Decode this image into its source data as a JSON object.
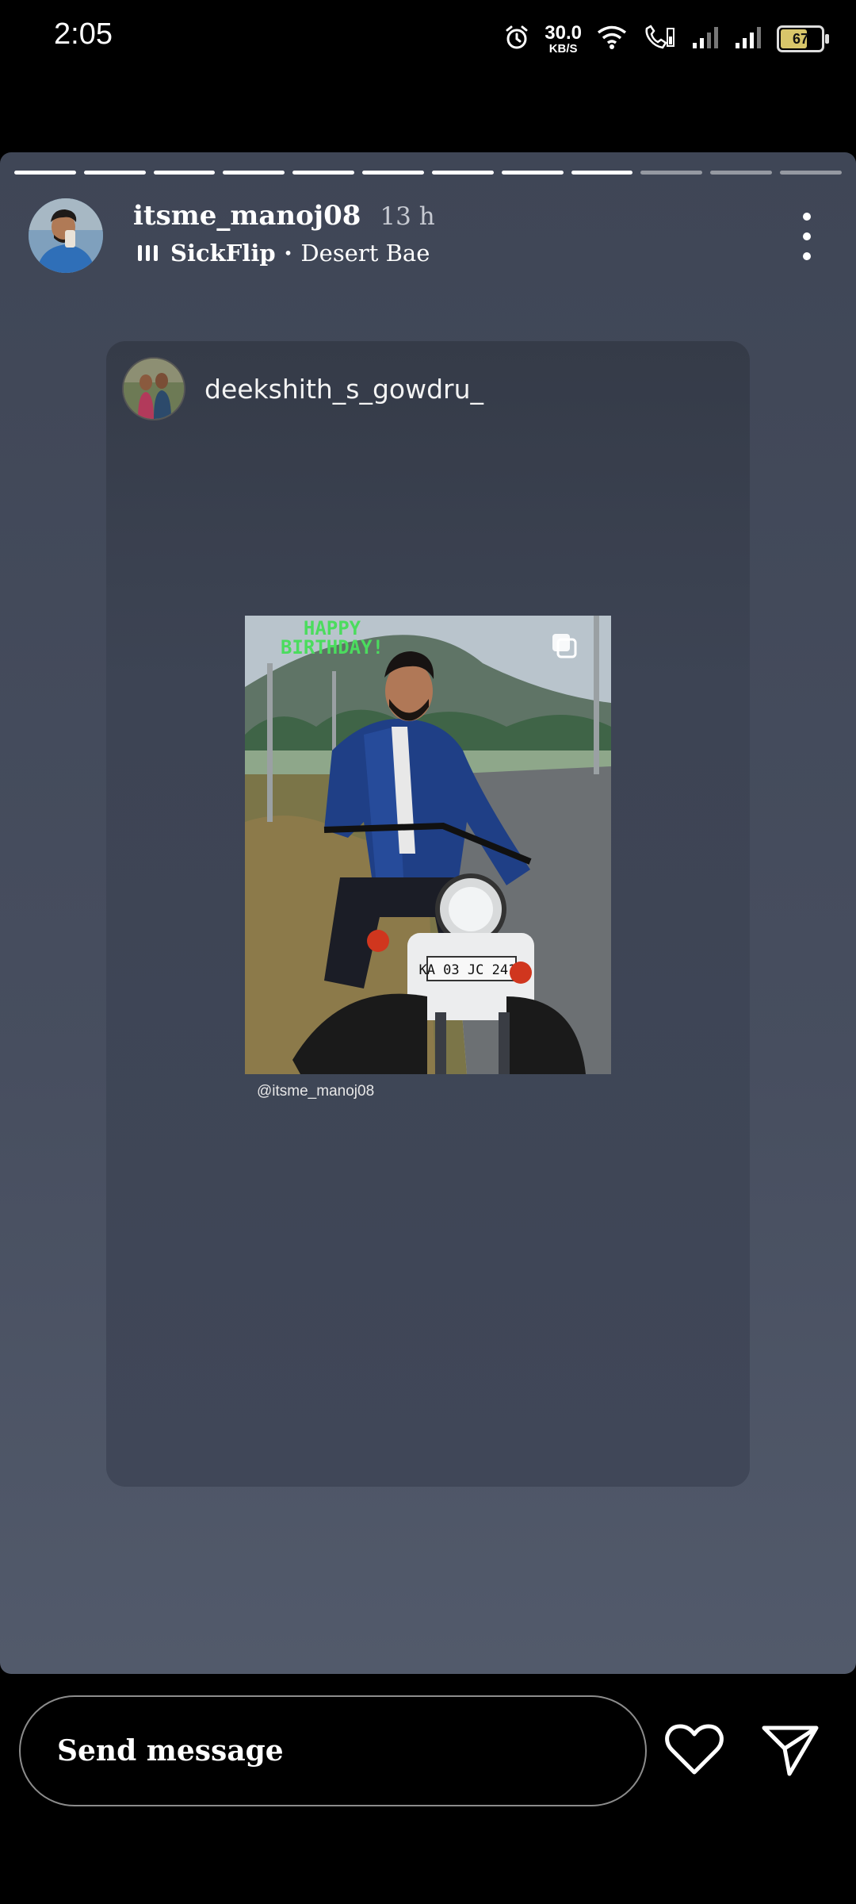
{
  "status_bar": {
    "time": "2:05",
    "net_speed_value": "30.0",
    "net_speed_unit": "KB/S",
    "battery": "67",
    "icons": [
      "alarm-icon",
      "wifi-icon",
      "wifi-calling-icon",
      "signal-icon",
      "signal-icon",
      "battery-icon"
    ]
  },
  "story": {
    "progress_total": 12,
    "progress_viewed": 9,
    "username": "itsme_manoj08",
    "time_ago": "13 h",
    "music_artist": "SickFlip",
    "music_separator": "•",
    "music_title": "Desert Bae"
  },
  "post": {
    "author": "deekshith_s_gowdru_",
    "image_overlay_text_line1": "HAPPY",
    "image_overlay_text_line2": "BIRTHDAY!",
    "plate_text": "KA 03 JC 2410",
    "mention": "@itsme_manoj08"
  },
  "footer": {
    "message_placeholder": "Send message"
  },
  "colors": {
    "background": "#000000",
    "story_bg": "#474e5f",
    "card_bg": "#3d4454",
    "progress_active": "#ffffff"
  }
}
